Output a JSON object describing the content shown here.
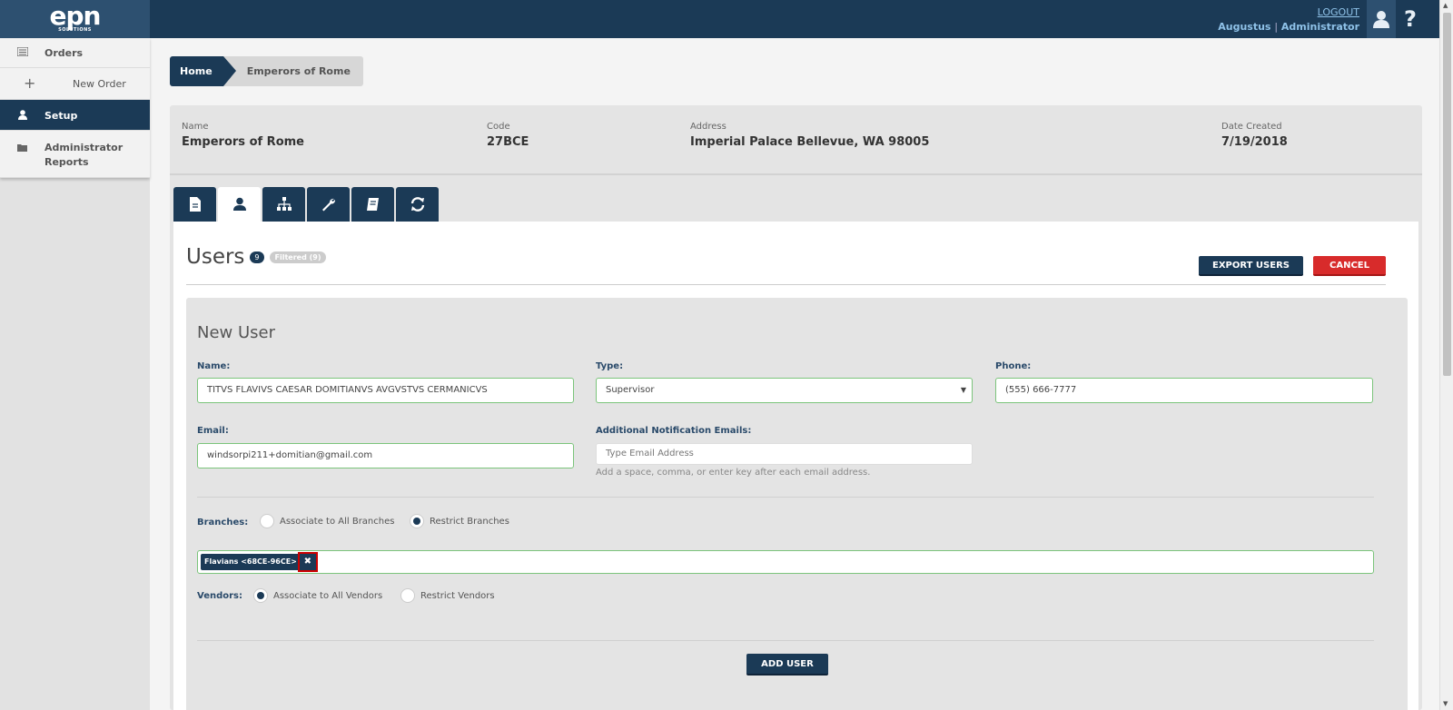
{
  "header": {
    "logo_text": "epn",
    "logo_subtext": "SOLUTIONS",
    "logout_label": "LOGOUT",
    "user_name": "Augustus",
    "user_separator": "|",
    "user_role": "Administrator",
    "help_icon": "?"
  },
  "sidebar": {
    "items": [
      {
        "label": "Orders",
        "icon": "list-icon"
      },
      {
        "label": "New Order",
        "icon": "plus-icon"
      },
      {
        "label": "Setup",
        "icon": "user-icon"
      },
      {
        "label": "Administrator Reports",
        "icon": "folder-icon"
      }
    ]
  },
  "breadcrumb": {
    "home": "Home",
    "current": "Emperors of Rome"
  },
  "info": {
    "name_label": "Name",
    "name_value": "Emperors of Rome",
    "code_label": "Code",
    "code_value": "27BCE",
    "address_label": "Address",
    "address_value": "Imperial Palace Bellevue, WA 98005",
    "date_label": "Date Created",
    "date_value": "7/19/2018"
  },
  "tabs": [
    {
      "icon": "document-icon"
    },
    {
      "icon": "user-icon",
      "active": true
    },
    {
      "icon": "sitemap-icon"
    },
    {
      "icon": "wrench-icon"
    },
    {
      "icon": "book-icon"
    },
    {
      "icon": "refresh-icon"
    }
  ],
  "users": {
    "title": "Users",
    "count": "9",
    "filtered": "Filtered (9)",
    "export_label": "EXPORT USERS",
    "cancel_label": "CANCEL"
  },
  "form": {
    "title": "New User",
    "name_label": "Name:",
    "name_value": "TITVS FLAVIVS CAESAR DOMITIANVS AVGVSTVS CERMANICVS",
    "type_label": "Type:",
    "type_value": "Supervisor",
    "phone_label": "Phone:",
    "phone_value": "(555) 666-7777",
    "email_label": "Email:",
    "email_value": "windsorpi211+domitian@gmail.com",
    "notif_label": "Additional Notification Emails:",
    "notif_placeholder": "Type Email Address",
    "notif_helper": "Add a space, comma, or enter key after each email address.",
    "branches_label": "Branches:",
    "branches_all": "Associate to All Branches",
    "branches_restrict": "Restrict Branches",
    "branch_tag": "Flavians <68CE-96CE>",
    "vendors_label": "Vendors:",
    "vendors_all": "Associate to All Vendors",
    "vendors_restrict": "Restrict Vendors",
    "add_label": "ADD USER"
  },
  "colors": {
    "navy": "#1b3a56",
    "danger": "#d82b2b",
    "valid_border": "#7bc47b"
  }
}
